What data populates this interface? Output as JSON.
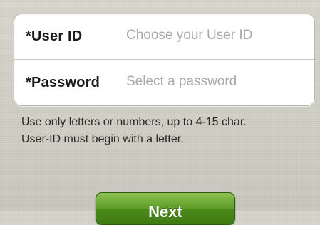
{
  "form": {
    "user_id": {
      "label": "*User ID",
      "value": "",
      "placeholder": "Choose your User ID"
    },
    "password": {
      "label": "*Password",
      "value": "",
      "placeholder": "Select a password"
    }
  },
  "hint": {
    "line1": "Use only letters or numbers, up to 4-15 char.",
    "line2": "User-ID must begin with a letter."
  },
  "actions": {
    "next_label": "Next"
  },
  "colors": {
    "background": "#d3d2c8",
    "card": "#ffffff",
    "placeholder": "#a9a9a9",
    "next_button": "#5e9b28"
  }
}
